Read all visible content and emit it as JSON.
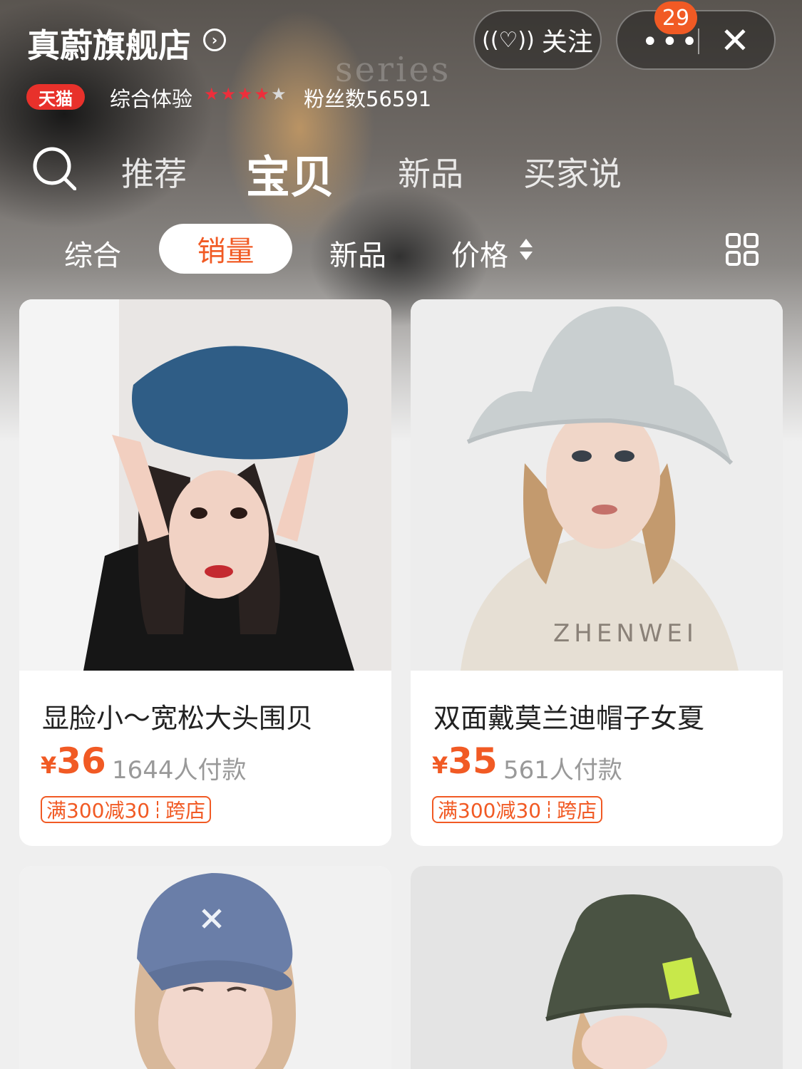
{
  "header": {
    "store_name": "真蔚旗舰店",
    "follow_label": "关注",
    "notification_count": "29",
    "tmall_badge": "天猫",
    "experience_label": "综合体验",
    "stars_filled": 4,
    "stars_total": 5,
    "fans": "粉丝数56591",
    "hero_text": "series"
  },
  "tabs": [
    "推荐",
    "宝贝",
    "新品",
    "买家说"
  ],
  "sort": {
    "items": [
      "综合",
      "销量",
      "新品",
      "价格"
    ],
    "active": "销量"
  },
  "products": [
    {
      "title": "显脸小～宽松大头围贝",
      "currency": "¥",
      "price": "36",
      "sold": "1644人付款",
      "promo": "满300减30",
      "promo_tag": "跨店",
      "image": "model-blue-beret",
      "colors": {
        "bg": "#e9e6e4",
        "hat": "#2f5d86"
      }
    },
    {
      "title": "双面戴莫兰迪帽子女夏",
      "currency": "¥",
      "price": "35",
      "sold": "561人付款",
      "promo": "满300减30",
      "promo_tag": "跨店",
      "image": "model-bucket-hat",
      "shirt_text": "ZHENWEI",
      "colors": {
        "bg": "#ededed",
        "hat": "#c9cfd0"
      }
    },
    {
      "title": "",
      "currency": "",
      "price": "",
      "sold": "",
      "promo": "",
      "promo_tag": "",
      "image": "model-blue-cap",
      "colors": {
        "bg": "#f1f1f1",
        "hat": "#6a7ea8"
      }
    },
    {
      "title": "",
      "currency": "",
      "price": "",
      "sold": "",
      "promo": "",
      "promo_tag": "",
      "image": "model-green-bucket",
      "colors": {
        "bg": "#e4e4e4",
        "hat": "#4a5343"
      }
    }
  ],
  "colors": {
    "accent": "#f15a24",
    "tmall": "#e8312b"
  }
}
